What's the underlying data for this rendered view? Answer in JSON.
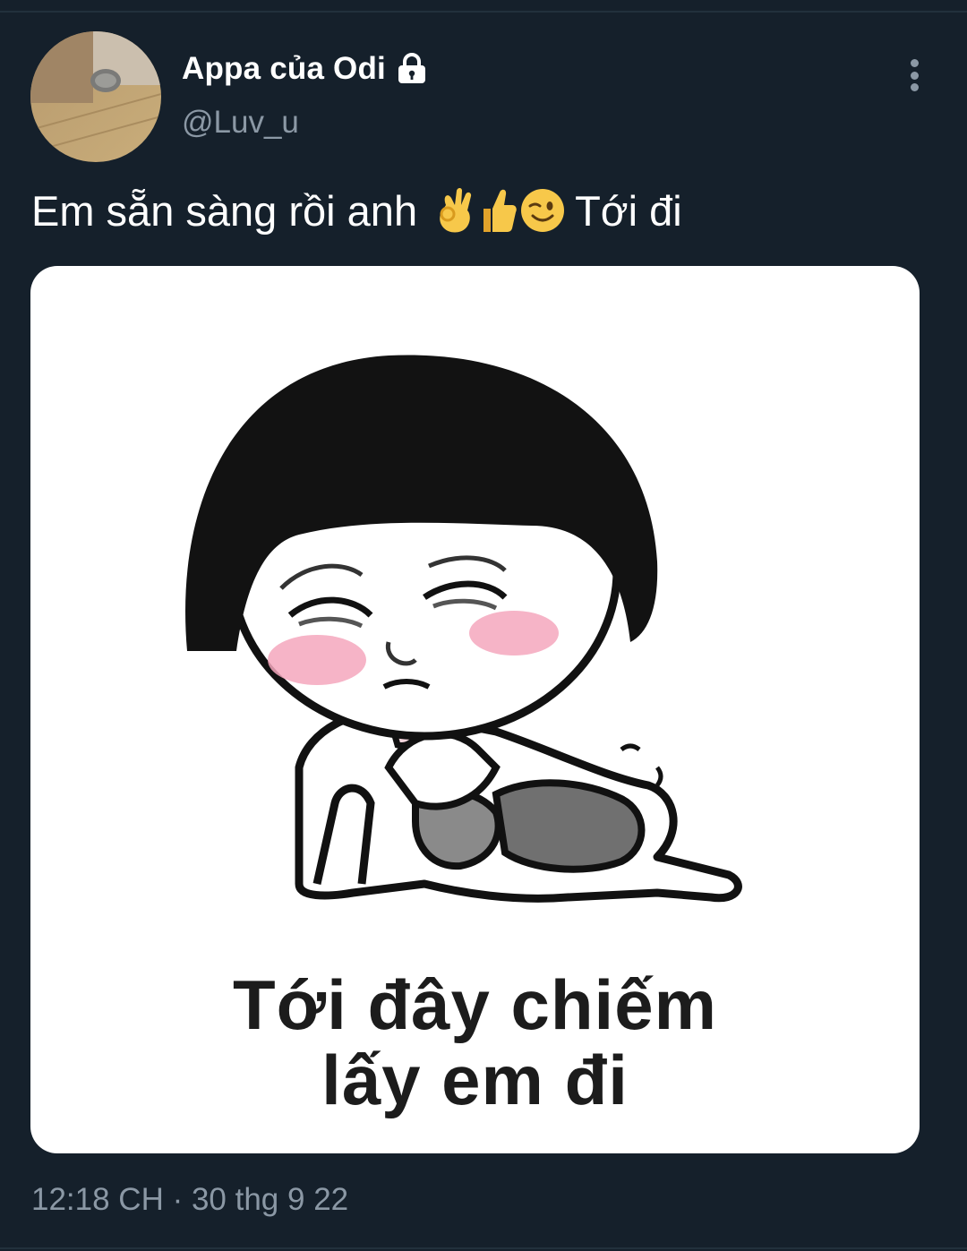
{
  "colors": {
    "background": "#15202b",
    "primary_text": "#ffffff",
    "secondary_text": "#8b98a5",
    "divider": "#22303c"
  },
  "author": {
    "display_name": "Appa của Odi",
    "handle": "@Luv_u",
    "avatar_icon": "avatar-photo",
    "protected_icon": "lock-icon"
  },
  "tweet": {
    "text_before_emoji": "Em sẵn sàng rồi anh",
    "emoji": [
      "ok-hand-emoji",
      "thumbs-up-emoji",
      "winking-face-emoji"
    ],
    "text_after_emoji": "Tới đi"
  },
  "media": {
    "caption_line_1": "Tới đây chiếm",
    "caption_line_2": "lấy em đi"
  },
  "meta": {
    "timestamp": "12:18 CH · 30 thg 9 22"
  },
  "actions": {
    "more_icon": "more-vertical-icon"
  }
}
